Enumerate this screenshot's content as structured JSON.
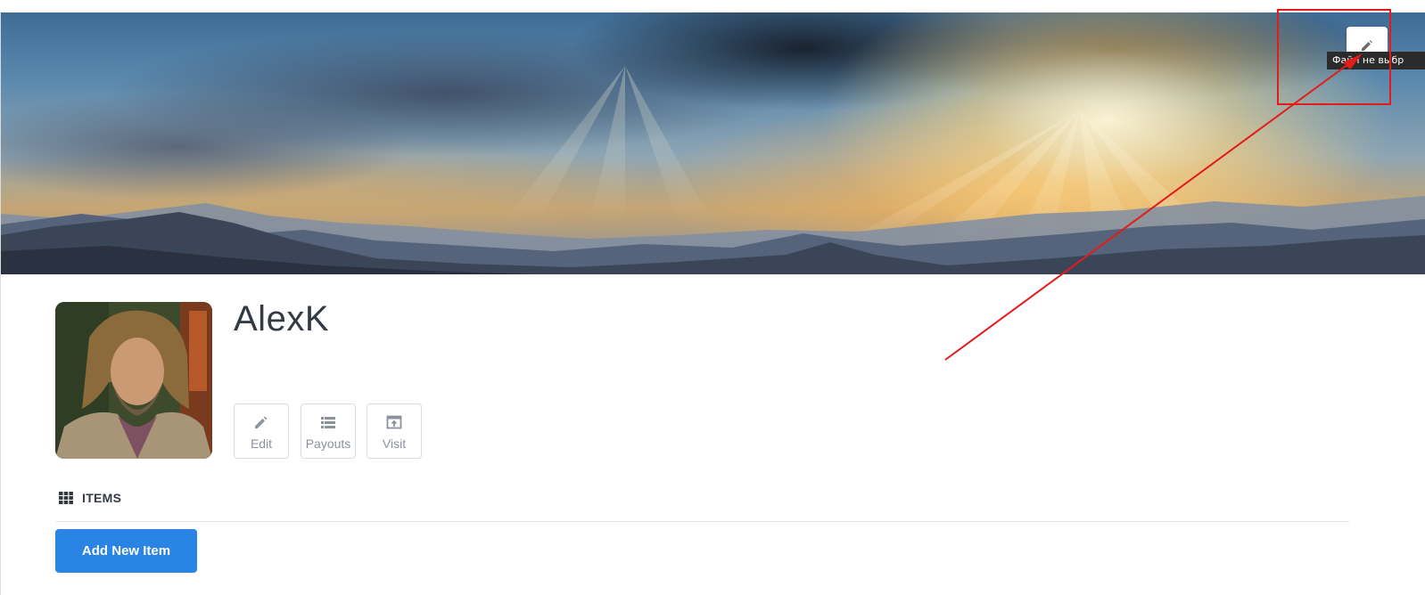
{
  "profile": {
    "username": "AlexK",
    "avatar_icon": "profile-photo"
  },
  "cover": {
    "edit_icon": "pencil-icon",
    "tooltip": "Файл не выбр"
  },
  "actions": [
    {
      "label": "Edit",
      "icon": "pencil-icon"
    },
    {
      "label": "Payouts",
      "icon": "list-icon"
    },
    {
      "label": "Visit",
      "icon": "external-link-icon"
    }
  ],
  "items_section": {
    "title": "ITEMS",
    "icon": "grid-icon",
    "add_button_label": "Add New Item"
  },
  "colors": {
    "accent": "#2a84e6",
    "annotation": "#e41b1b"
  }
}
